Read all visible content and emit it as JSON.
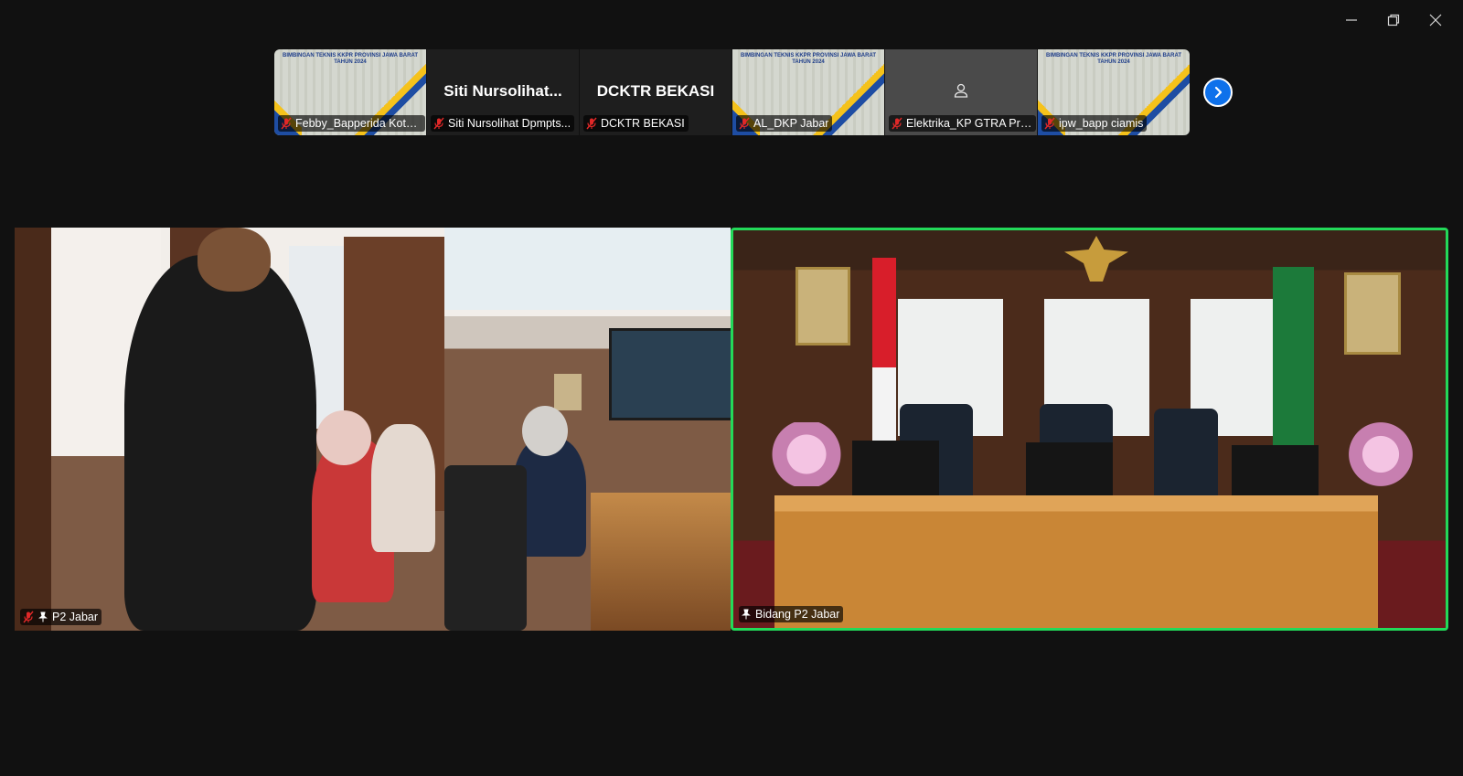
{
  "window": {
    "minimize_label": "Minimize",
    "restore_label": "Restore",
    "close_label": "Close"
  },
  "thumbnails": [
    {
      "type": "slide",
      "slide_title": "BIMBINGAN TEKNIS KKPR PROVINSI JAWA BARAT TAHUN 2024",
      "label": "Febby_Bapperida Kota ...",
      "muted": true
    },
    {
      "type": "name",
      "display_name": "Siti Nursolihat...",
      "label": "Siti Nursolihat Dpmpts...",
      "muted": true
    },
    {
      "type": "name",
      "display_name": "DCKTR BEKASI",
      "label": "DCKTR BEKASI",
      "muted": true
    },
    {
      "type": "slide",
      "slide_title": "BIMBINGAN TEKNIS KKPR PROVINSI JAWA BARAT TAHUN 2024",
      "label": "AL_DKP Jabar",
      "muted": true
    },
    {
      "type": "avatar",
      "label": "Elektrika_KP GTRA Pro...",
      "muted": true
    },
    {
      "type": "slide",
      "slide_title": "BIMBINGAN TEKNIS KKPR PROVINSI JAWA BARAT TAHUN 2024",
      "label": "ipw_bapp ciamis",
      "muted": true
    }
  ],
  "main_videos": {
    "left": {
      "label": "P2 Jabar",
      "muted": true,
      "pinned": true
    },
    "right": {
      "label": "Bidang P2 Jabar",
      "muted": false,
      "pinned": true,
      "active_speaker": true
    }
  },
  "colors": {
    "background": "#111111",
    "active_speaker_border": "#23d959",
    "next_button": "#0e71eb",
    "mic_muted": "#e02828"
  },
  "icons": {
    "next": "chevron-right-icon",
    "muted": "mic-off-icon",
    "pin": "pin-icon",
    "avatar": "user-silhouette-icon"
  }
}
